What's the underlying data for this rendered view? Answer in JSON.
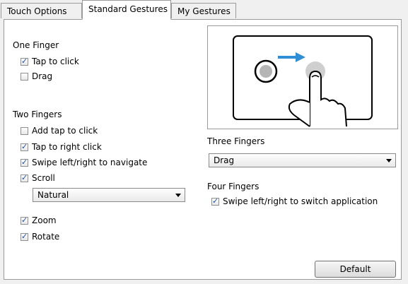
{
  "tabs": [
    {
      "label": "Touch Options"
    },
    {
      "label": "Standard Gestures"
    },
    {
      "label": "My Gestures"
    }
  ],
  "one_finger": {
    "heading": "One Finger",
    "tap_to_click": {
      "label": "Tap to click",
      "checked": true
    },
    "drag": {
      "label": "Drag",
      "checked": false
    }
  },
  "two_fingers": {
    "heading": "Two Fingers",
    "add_tap_to_click": {
      "label": "Add tap to click",
      "checked": false
    },
    "tap_to_right_click": {
      "label": "Tap to right click",
      "checked": true
    },
    "swipe_navigate": {
      "label": "Swipe left/right to navigate",
      "checked": true
    },
    "scroll": {
      "label": "Scroll",
      "checked": true
    },
    "scroll_mode": {
      "value": "Natural"
    },
    "zoom": {
      "label": "Zoom",
      "checked": true
    },
    "rotate": {
      "label": "Rotate",
      "checked": true
    }
  },
  "three_fingers": {
    "heading": "Three Fingers",
    "action": {
      "value": "Drag"
    }
  },
  "four_fingers": {
    "heading": "Four Fingers",
    "swipe_switch": {
      "label": "Swipe left/right to switch application",
      "checked": true
    }
  },
  "buttons": {
    "default_label": "Default"
  },
  "colors": {
    "arrow": "#2e8fd6",
    "check": "#1f4e9a"
  }
}
